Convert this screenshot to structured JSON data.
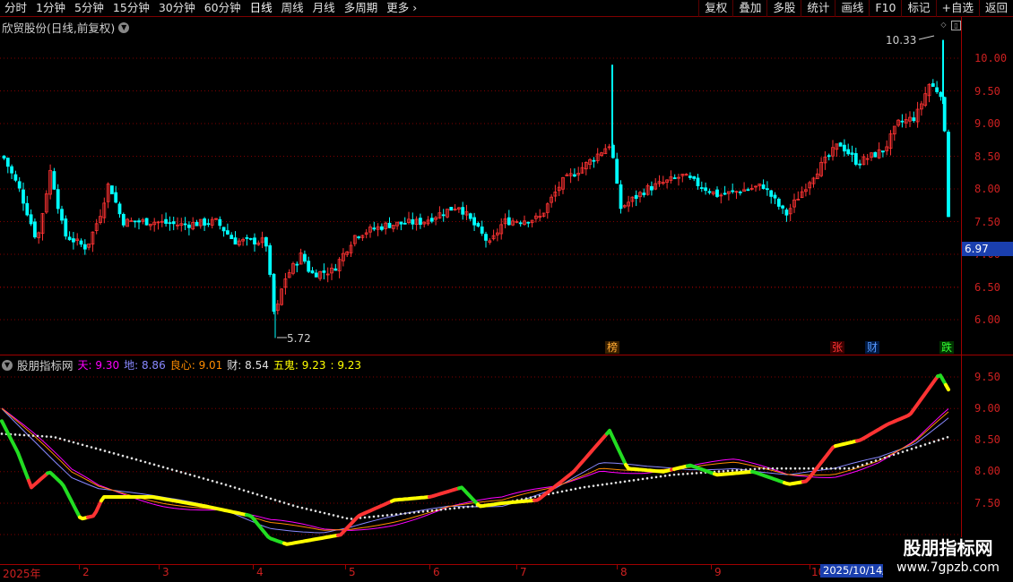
{
  "toolbar": {
    "periods": [
      "分时",
      "1分钟",
      "5分钟",
      "15分钟",
      "30分钟",
      "60分钟",
      "日线",
      "周线",
      "月线",
      "多周期",
      "更多"
    ],
    "active_period": "日线",
    "buttons": [
      "复权",
      "叠加",
      "多股",
      "统计",
      "画线",
      "F10",
      "标记",
      "+自选",
      "返回"
    ]
  },
  "main_chart": {
    "title": "欣贸股份(日线,前复权)",
    "price_labels": [
      "10.00",
      "9.50",
      "9.00",
      "8.50",
      "8.00",
      "7.50",
      "7.00",
      "6.50",
      "6.00"
    ],
    "current_price": "6.97",
    "high_annotation": "10.33",
    "low_annotation": "5.72",
    "badges": {
      "bang": "榜",
      "zhang": "张",
      "cai": "财",
      "die": "跌"
    }
  },
  "indicator": {
    "name": "股朋指标网",
    "tian_label": "天:",
    "tian_value": "9.30",
    "di_label": "地:",
    "di_value": "8.86",
    "liangxin_label": "良心:",
    "liangxin_value": "9.01",
    "cai_label": "财:",
    "cai_value": "8.54",
    "wugui_label": "五鬼:",
    "wugui_value": "9.23",
    "extra_value": ": 9.23",
    "axis_labels": [
      "9.50",
      "9.00",
      "8.50",
      "8.00",
      "7.50"
    ]
  },
  "date_axis": {
    "labels": [
      "2025年",
      "2",
      "3",
      "4",
      "5",
      "6",
      "7",
      "8",
      "9",
      "10"
    ],
    "cursor_date": "2025/10/14/"
  },
  "watermark": {
    "title": "股朋指标网",
    "url": "www.7gpzb.com"
  },
  "colors": {
    "up": "#ff3333",
    "down": "#00ffff",
    "grid": "#800000",
    "axis": "#cc2020",
    "tian": "#ff00ff",
    "di": "#8888ff",
    "liangxin": "#ff8c00",
    "wugui": "#ffff00"
  }
}
